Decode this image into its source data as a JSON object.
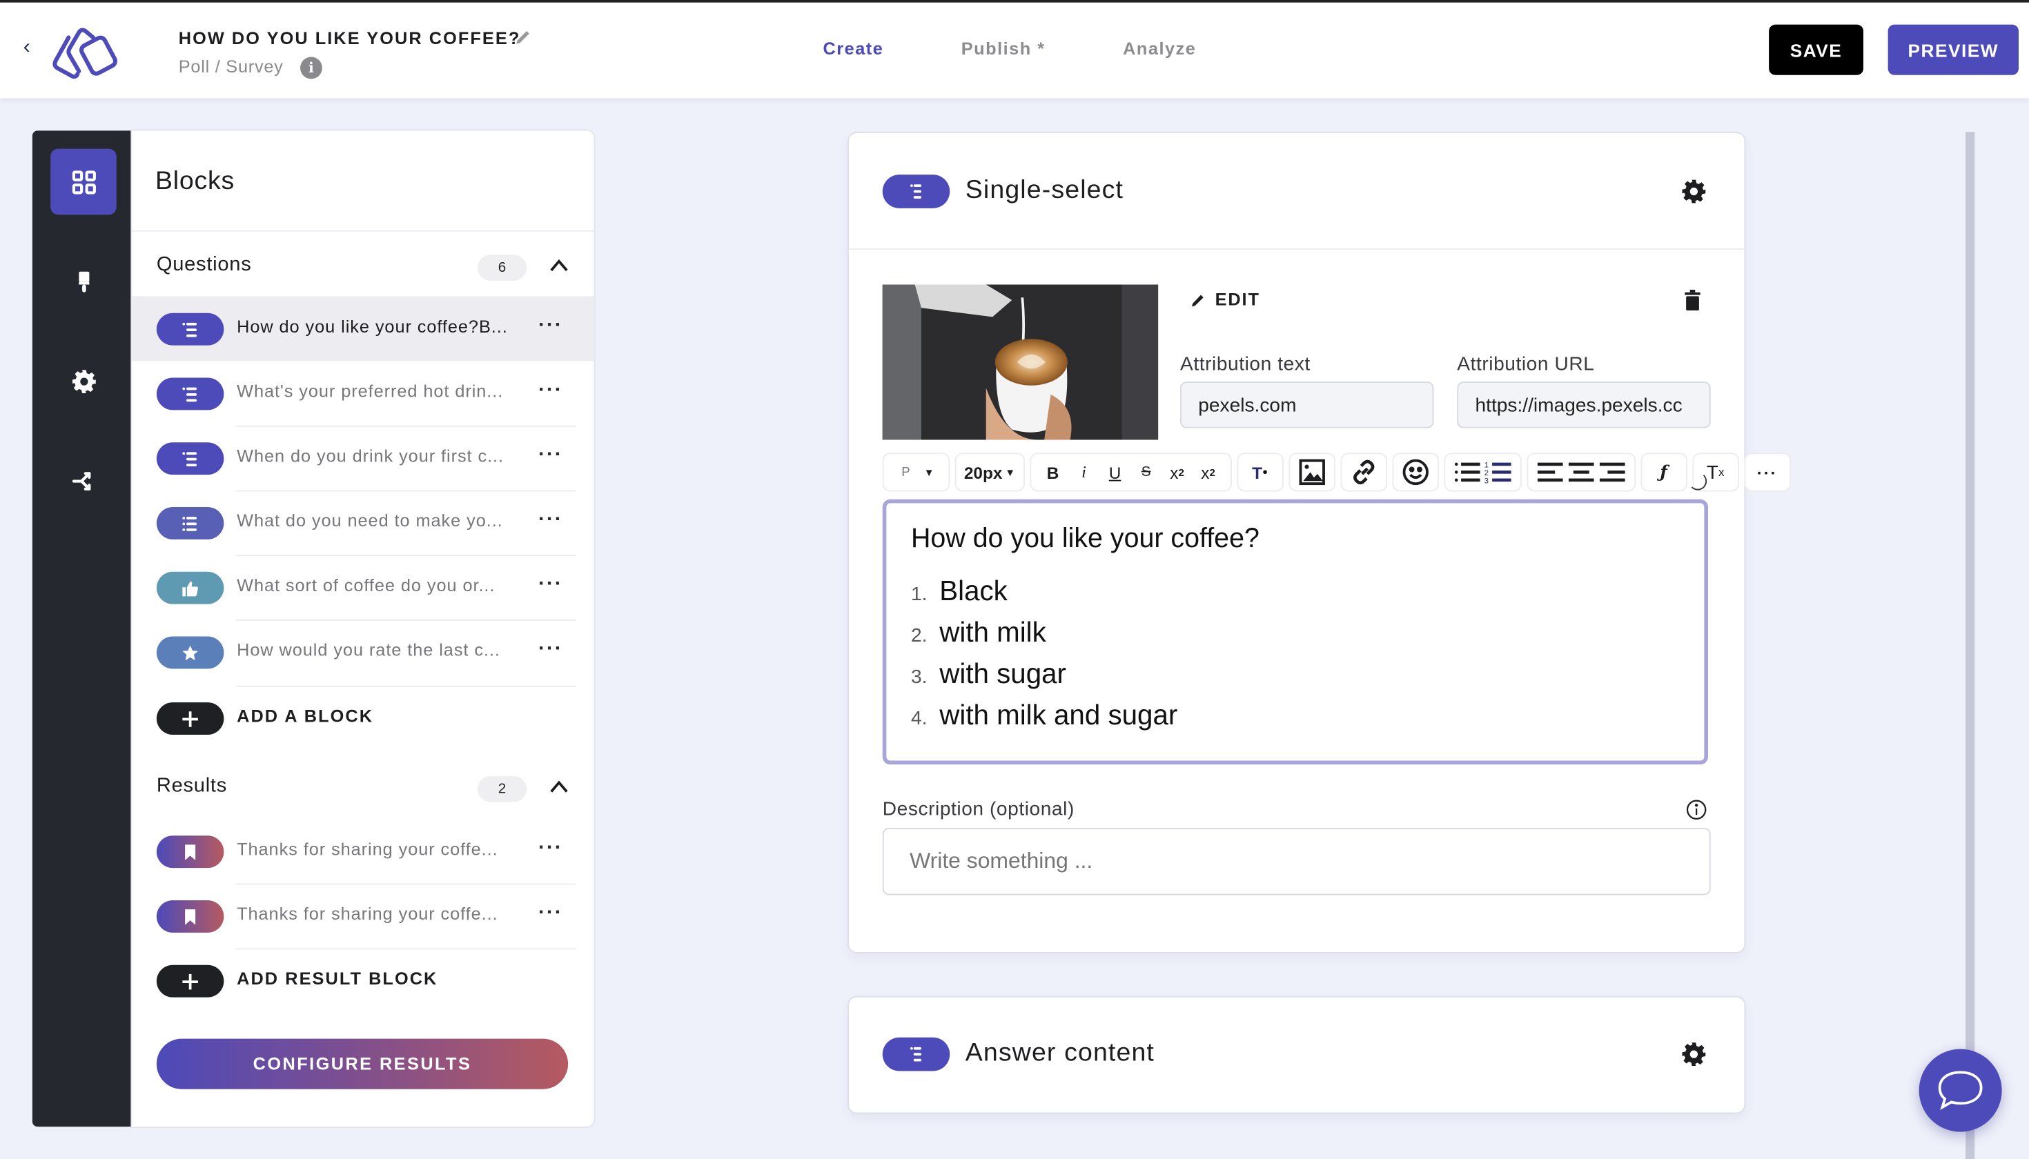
{
  "header": {
    "back_icon": "chevron-left-icon",
    "logo": "stacked-squares-logo",
    "title": "HOW DO YOU LIKE YOUR COFFEE?",
    "title_edit_icon": "pencil-icon",
    "subtitle": "Poll / Survey",
    "info_icon": "info-icon",
    "tabs": [
      {
        "label": "Create",
        "active": true
      },
      {
        "label": "Publish *",
        "active": false
      },
      {
        "label": "Analyze",
        "active": false
      }
    ],
    "save_label": "SAVE",
    "preview_label": "PREVIEW"
  },
  "rail": {
    "items": [
      {
        "icon": "grid-icon",
        "active": true
      },
      {
        "icon": "paint-brush-icon",
        "active": false
      },
      {
        "icon": "gear-icon",
        "active": false
      },
      {
        "icon": "branch-icon",
        "active": false
      }
    ]
  },
  "blocks_panel": {
    "title": "Blocks",
    "questions": {
      "label": "Questions",
      "count": "6",
      "items": [
        {
          "text": "How do you like your coffee?B...",
          "icon": "list-icon",
          "selected": true
        },
        {
          "text": "What's your preferred hot drin...",
          "icon": "list-icon",
          "selected": false
        },
        {
          "text": "When do you drink your first c...",
          "icon": "list-icon",
          "selected": false
        },
        {
          "text": "What do you need to make yo...",
          "icon": "list-icon",
          "selected": false
        },
        {
          "text": "What sort of coffee do you or...",
          "icon": "thumbs-up-icon",
          "selected": false
        },
        {
          "text": "How would you rate the last c...",
          "icon": "star-icon",
          "selected": false
        }
      ],
      "add_label": "ADD A BLOCK"
    },
    "results": {
      "label": "Results",
      "count": "2",
      "items": [
        {
          "text": "Thanks for sharing your coffe...",
          "icon": "bookmark-icon"
        },
        {
          "text": "Thanks for sharing your coffe...",
          "icon": "bookmark-icon"
        }
      ],
      "add_label": "ADD RESULT BLOCK"
    },
    "configure_label": "CONFIGURE RESULTS"
  },
  "editor_card": {
    "type_label": "Single-select",
    "edit_label": "EDIT",
    "attribution_text_label": "Attribution text",
    "attribution_text_value": "pexels.com",
    "attribution_url_label": "Attribution URL",
    "attribution_url_value": "https://images.pexels.cc",
    "toolbar": {
      "paragraph": "P",
      "font_size": "20px",
      "buttons": [
        "bold",
        "italic",
        "underline",
        "strikethrough",
        "superscript",
        "subscript",
        "text-color",
        "image",
        "link",
        "emoji",
        "bullet-list",
        "numbered-list",
        "align-left",
        "align-center",
        "align-right",
        "formula",
        "clear-format",
        "more"
      ]
    },
    "question": "How do you like your coffee?",
    "options": [
      {
        "num": "1.",
        "text": "Black"
      },
      {
        "num": "2.",
        "text": "with milk"
      },
      {
        "num": "3.",
        "text": "with sugar"
      },
      {
        "num": "4.",
        "text": "with milk and sugar"
      }
    ],
    "description_label": "Description (optional)",
    "description_placeholder": "Write something ..."
  },
  "answer_card": {
    "type_label": "Answer content"
  },
  "colors": {
    "accent": "#4d4ab9",
    "rail": "#26282f",
    "thumbs_pill": "#5f9ab3",
    "star_pill": "#5b7fb8",
    "result_gradient_start": "#4d4ab9",
    "result_gradient_end": "#b55a60"
  }
}
